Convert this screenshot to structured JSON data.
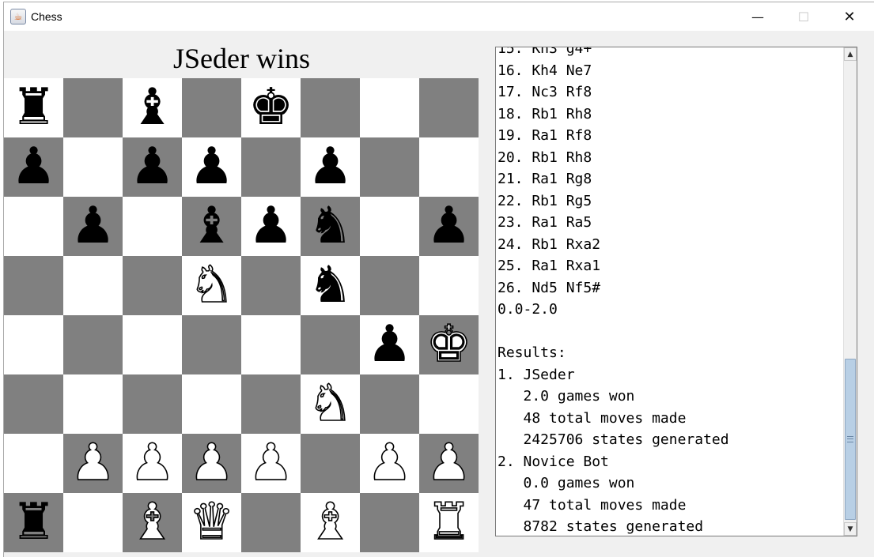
{
  "window": {
    "title": "Chess",
    "app_icon": "java-cup-icon",
    "controls": {
      "minimize": "—",
      "maximize": "☐",
      "close": "✕"
    }
  },
  "status": "JSeder wins",
  "board": {
    "colors": {
      "light": "#ffffff",
      "dark": "#808080"
    },
    "ranks": [
      [
        "bR",
        "",
        "bB",
        "",
        "bK",
        "",
        "",
        ""
      ],
      [
        "bP",
        "",
        "bP",
        "bP",
        "",
        "bP",
        "",
        ""
      ],
      [
        "",
        "bP",
        "",
        "bB",
        "bP",
        "bN",
        "",
        "bP"
      ],
      [
        "",
        "",
        "",
        "wN",
        "",
        "bN",
        "",
        ""
      ],
      [
        "",
        "",
        "",
        "",
        "",
        "",
        "bP",
        "wK"
      ],
      [
        "",
        "",
        "",
        "",
        "",
        "wN",
        "",
        ""
      ],
      [
        "",
        "wP",
        "wP",
        "wP",
        "wP",
        "",
        "wP",
        "wP"
      ],
      [
        "bR",
        "",
        "wB",
        "wQ",
        "",
        "wB",
        "",
        "wR"
      ]
    ]
  },
  "move_log": {
    "lines": [
      "15. Kh3 g4+",
      "16. Kh4 Ne7",
      "17. Nc3 Rf8",
      "18. Rb1 Rh8",
      "19. Ra1 Rf8",
      "20. Rb1 Rh8",
      "21. Ra1 Rg8",
      "22. Rb1 Rg5",
      "23. Ra1 Ra5",
      "24. Rb1 Rxa2",
      "25. Ra1 Rxa1",
      "26. Nd5 Nf5#",
      "0.0-2.0",
      "",
      "Results:",
      "1. JSeder",
      "   2.0 games won",
      "   48 total moves made",
      "   2425706 states generated",
      "2. Novice Bot",
      "   0.0 games won",
      "   47 total moves made",
      "   8782 states generated"
    ]
  },
  "scrollbar": {
    "up_arrow": "▲",
    "down_arrow": "▼"
  }
}
